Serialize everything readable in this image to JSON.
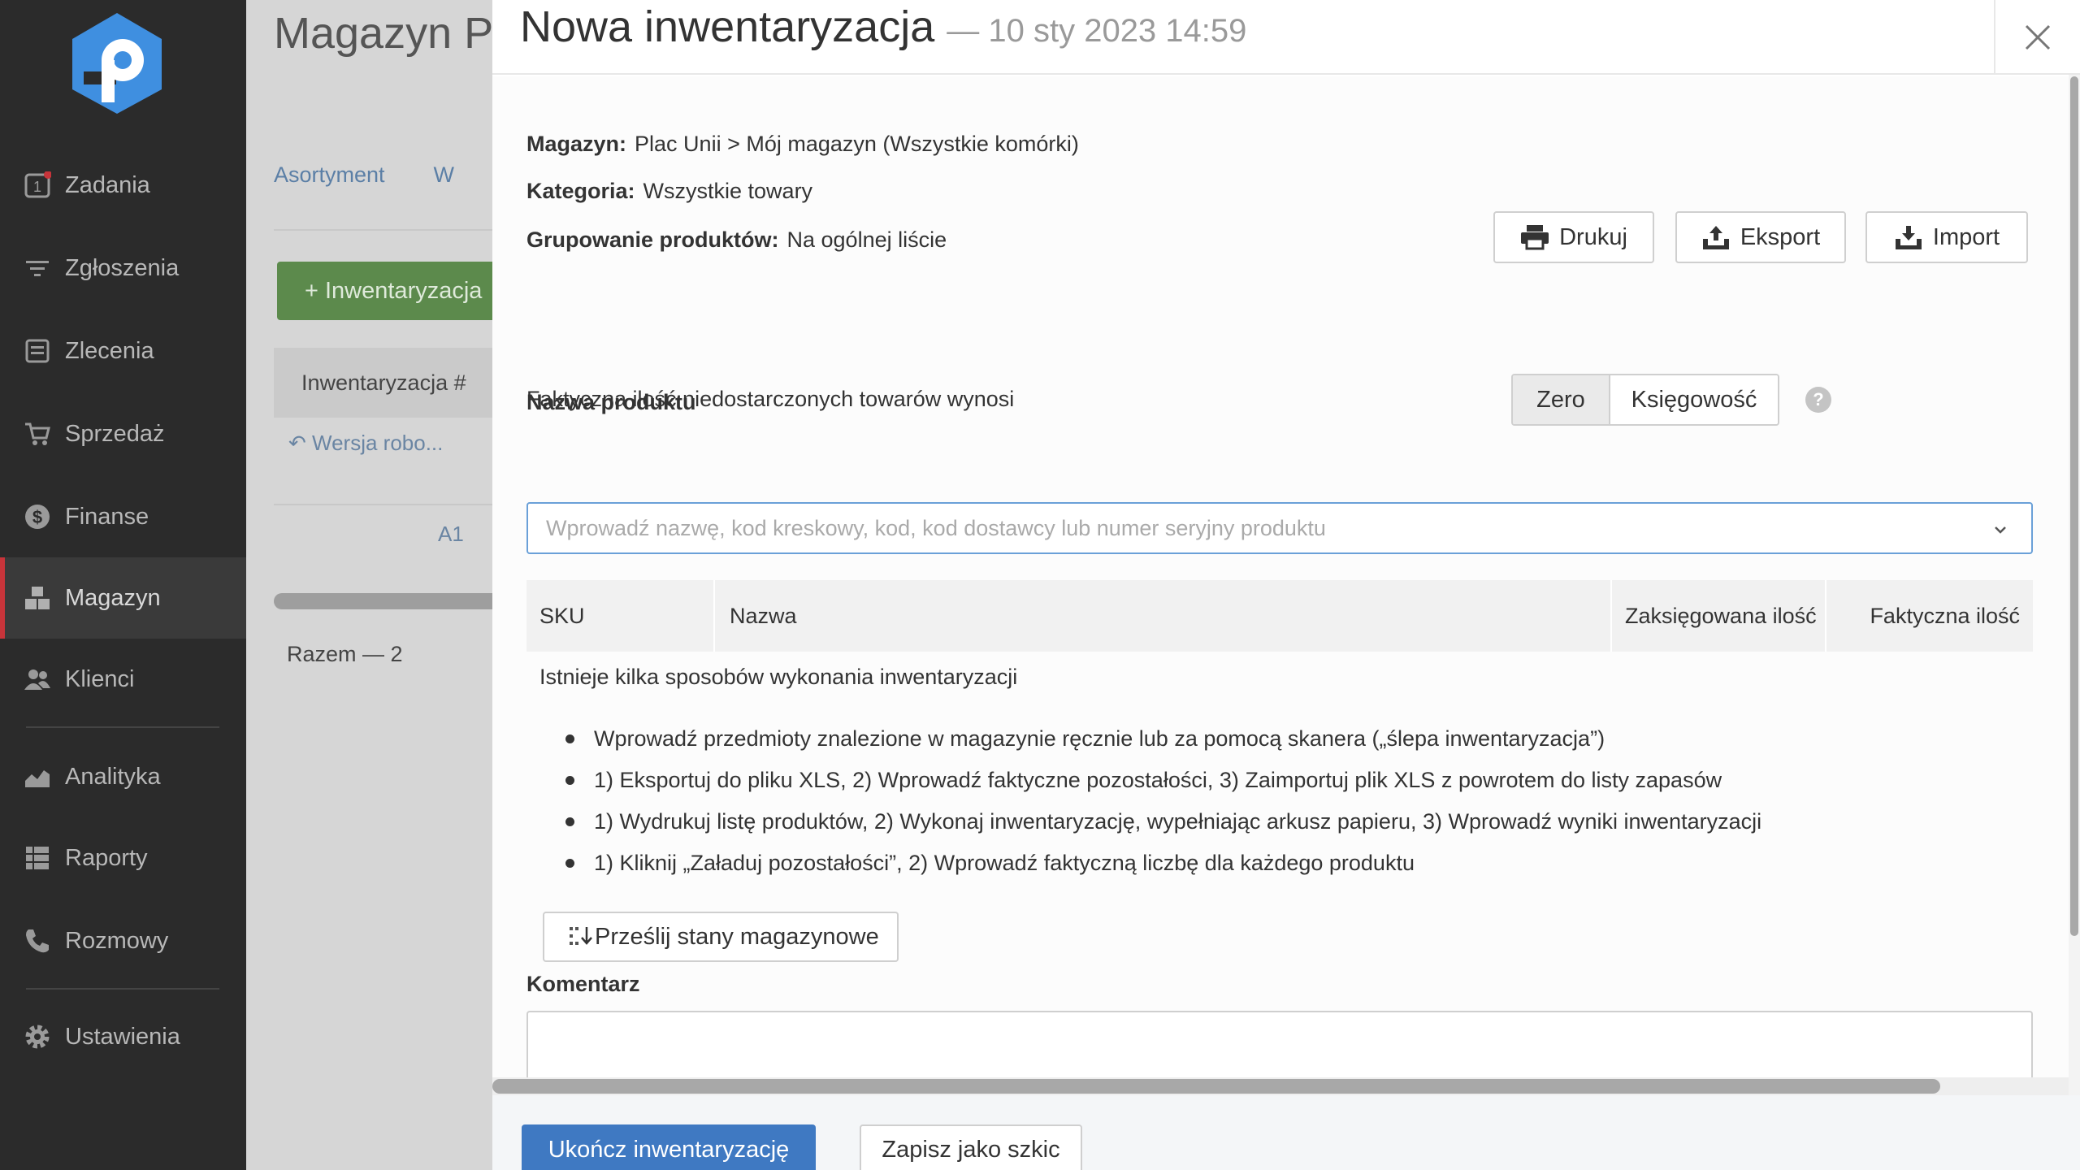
{
  "sidebar": {
    "logo_icon": "app-logo-icon",
    "items": [
      {
        "label": "Zadania",
        "icon": "tasks-icon",
        "badge": "1"
      },
      {
        "label": "Zgłoszenia",
        "icon": "filter-icon"
      },
      {
        "label": "Zlecenia",
        "icon": "orders-icon"
      },
      {
        "label": "Sprzedaż",
        "icon": "cart-icon"
      },
      {
        "label": "Finanse",
        "icon": "dollar-icon"
      },
      {
        "label": "Magazyn",
        "icon": "warehouse-icon",
        "active": true
      },
      {
        "label": "Klienci",
        "icon": "users-icon"
      },
      {
        "label": "Analityka",
        "icon": "chart-icon"
      },
      {
        "label": "Raporty",
        "icon": "reports-icon"
      },
      {
        "label": "Rozmowy",
        "icon": "phone-icon"
      },
      {
        "label": "Ustawienia",
        "icon": "gear-icon"
      }
    ]
  },
  "background": {
    "title": "Magazyn  Pl",
    "tabs": [
      "Asortyment",
      "W"
    ],
    "add_button": "+ Inwentaryzacja",
    "table_header": "Inwentaryzacja #",
    "row_status": "Wersja robo...",
    "row_cell": "A1",
    "total": "Razem — 2"
  },
  "modal": {
    "title": "Nowa inwentaryzacja",
    "subtitle": "— 10 sty 2023 14:59",
    "info": {
      "warehouse_label": "Magazyn:",
      "warehouse_value": "Plac Unii > Mój magazyn (Wszystkie komórki)",
      "category_label": "Kategoria:",
      "category_value": "Wszystkie towary",
      "grouping_label": "Grupowanie produktów:",
      "grouping_value": "Na ogólnej liście"
    },
    "toolbar": {
      "print": "Drukuj",
      "export": "Eksport",
      "import": "Import"
    },
    "undelivered": {
      "label": "Faktyczna ilość niedostarczonych towarów wynosi",
      "option_zero": "Zero",
      "option_accounting": "Księgowość",
      "selected": "Zero",
      "help": "?"
    },
    "product_search": {
      "label": "Nazwa produktu",
      "placeholder": "Wprowadź nazwę, kod kreskowy, kod, kod dostawcy lub numer seryjny produktu",
      "value": ""
    },
    "table": {
      "columns": [
        "SKU",
        "Nazwa",
        "Zaksięgowana ilość",
        "Faktyczna ilość"
      ]
    },
    "hint": "Istnieje kilka sposobów wykonania inwentaryzacji",
    "hints": [
      "Wprowadź przedmioty znalezione w magazynie ręcznie lub za pomocą skanera („ślepa inwentaryzacja”)",
      "1) Eksportuj do pliku XLS, 2) Wprowadź faktyczne pozostałości, 3) Zaimportuj plik XLS z powrotem do listy zapasów",
      "1) Wydrukuj listę produktów, 2) Wykonaj inwentaryzację, wypełniając arkusz papieru, 3) Wprowadź wyniki inwentaryzacji",
      "1) Kliknij „Załaduj pozostałości”, 2) Wprowadź faktyczną liczbę dla każdego produktu"
    ],
    "upload_button": "Prześlij stany magazynowe",
    "comment_label": "Komentarz",
    "comment_value": "",
    "footer": {
      "finish": "Ukończ inwentaryzację",
      "save_draft": "Zapisz jako szkic"
    }
  },
  "colors": {
    "sidebar_bg": "#2b2b2b",
    "active_accent": "#c7343a",
    "primary": "#3f79c2",
    "logo": "#3f8fe0",
    "link": "#5b7fa6"
  }
}
